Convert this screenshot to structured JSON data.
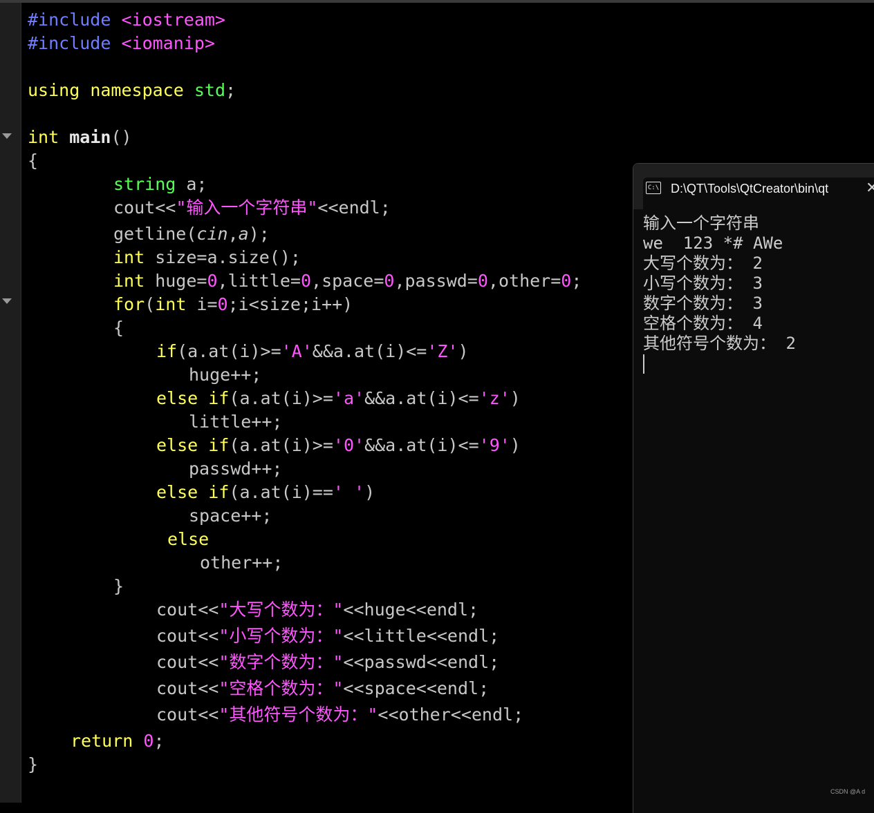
{
  "editor": {
    "lines": {
      "l1": [
        "#include",
        " <iostream>"
      ],
      "l2": [
        "#include",
        " <iomanip>"
      ],
      "l4": [
        "using",
        " ",
        "namespace",
        " ",
        "std",
        ";"
      ],
      "l6": [
        "int",
        " ",
        "main",
        "()"
      ],
      "l7": "{",
      "l8": [
        "string",
        " a;"
      ],
      "l9": [
        "cout<<",
        "\"输入一个字符串\"",
        "<<endl;"
      ],
      "l10": [
        "getline(",
        "cin",
        ",",
        "a",
        ");"
      ],
      "l11": [
        "int",
        " size=a.size();"
      ],
      "l12": [
        "int",
        " huge=",
        "0",
        ",little=",
        "0",
        ",space=",
        "0",
        ",passwd=",
        "0",
        ",other=",
        "0",
        ";"
      ],
      "l13": [
        "for",
        "(",
        "int",
        " i=",
        "0",
        ";i<size;i++)"
      ],
      "l14": "{",
      "l15": [
        "if",
        "(a.at(i)>=",
        "'A'",
        "&&a.at(i)<=",
        "'Z'",
        ")"
      ],
      "l16": "huge++;",
      "l17": [
        "else",
        " ",
        "if",
        "(a.at(i)>=",
        "'a'",
        "&&a.at(i)<=",
        "'z'",
        ")"
      ],
      "l18": "little++;",
      "l19": [
        "else",
        " ",
        "if",
        "(a.at(i)>=",
        "'0'",
        "&&a.at(i)<=",
        "'9'",
        ")"
      ],
      "l20": "passwd++;",
      "l21": [
        "else",
        " ",
        "if",
        "(a.at(i)==",
        "' '",
        ")"
      ],
      "l22": "space++;",
      "l23": "else",
      "l24": "other++;",
      "l25": "}",
      "l26": [
        "cout<<",
        "\"大写个数为：\"",
        "<<huge<<endl;"
      ],
      "l27": [
        "cout<<",
        "\"小写个数为：\"",
        "<<little<<endl;"
      ],
      "l28": [
        "cout<<",
        "\"数字个数为：\"",
        "<<passwd<<endl;"
      ],
      "l29": [
        "cout<<",
        "\"空格个数为：\"",
        "<<space<<endl;"
      ],
      "l30": [
        "cout<<",
        "\"其他符号个数为：\"",
        "<<other<<endl;"
      ],
      "l31": [
        "return",
        " ",
        "0",
        ";"
      ],
      "l32": "}"
    }
  },
  "console": {
    "title": "D:\\QT\\Tools\\QtCreator\\bin\\qt",
    "icon_text": "C:\\",
    "icon": "terminal-icon",
    "close_glyph": "✕",
    "output": [
      "输入一个字符串",
      "we  123 *# AWe",
      "大写个数为： 2",
      "小写个数为： 3",
      "数字个数为： 3",
      "空格个数为： 4",
      "其他符号个数为： 2"
    ]
  },
  "watermark": "CSDN @A d",
  "colors": {
    "background": "#000000",
    "preprocessor": "#6f7dff",
    "keyword": "#ffff55",
    "namespace": "#55ff55",
    "literal": "#ff55ff",
    "default_text": "#c8c8c8"
  }
}
